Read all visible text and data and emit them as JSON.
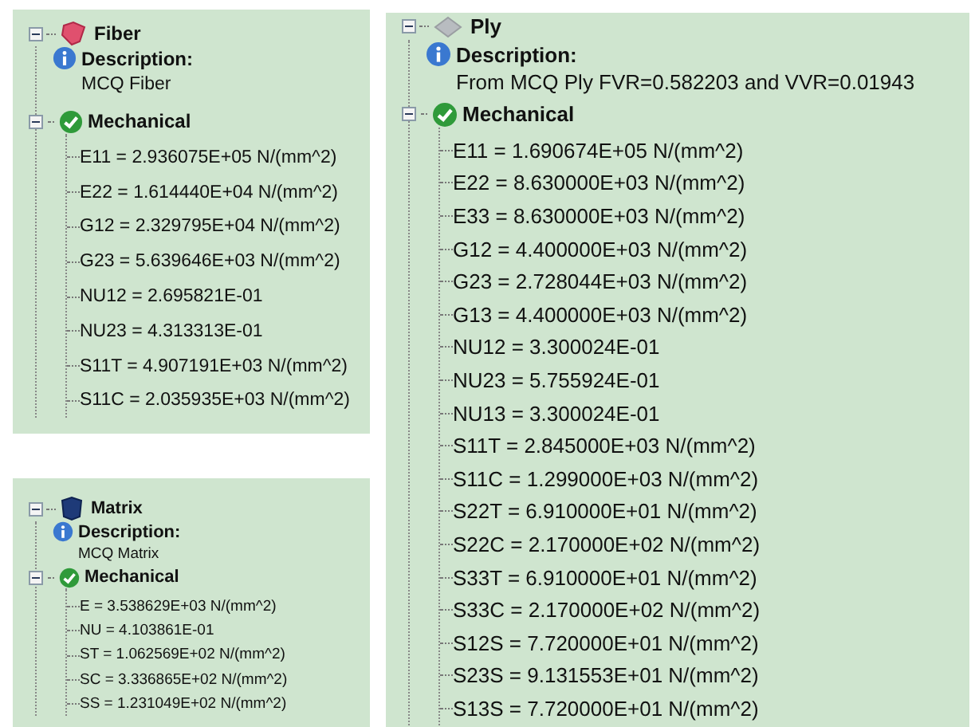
{
  "panels": [
    {
      "kind": "fiber",
      "title": "Fiber",
      "expanded": true,
      "description": {
        "label": "Description:",
        "text": "MCQ Fiber"
      },
      "mechanical": {
        "label": "Mechanical",
        "expanded": true,
        "properties": [
          "E11 = 2.936075E+05 N/(mm^2)",
          "E22 = 1.614440E+04 N/(mm^2)",
          "G12 = 2.329795E+04 N/(mm^2)",
          "G23 = 5.639646E+03 N/(mm^2)",
          "NU12 = 2.695821E-01",
          "NU23 = 4.313313E-01",
          "S11T = 4.907191E+03 N/(mm^2)",
          "S11C = 2.035935E+03 N/(mm^2)"
        ]
      }
    },
    {
      "kind": "matrix",
      "title": "Matrix",
      "expanded": true,
      "description": {
        "label": "Description:",
        "text": "MCQ Matrix"
      },
      "mechanical": {
        "label": "Mechanical",
        "expanded": true,
        "properties": [
          "E = 3.538629E+03 N/(mm^2)",
          "NU = 4.103861E-01",
          "ST = 1.062569E+02 N/(mm^2)",
          "SC = 3.336865E+02 N/(mm^2)",
          "SS = 1.231049E+02 N/(mm^2)"
        ]
      }
    },
    {
      "kind": "ply",
      "title": "Ply",
      "expanded": true,
      "description": {
        "label": "Description:",
        "text": "From MCQ Ply FVR=0.582203 and VVR=0.01943"
      },
      "mechanical": {
        "label": "Mechanical",
        "expanded": true,
        "properties": [
          "E11 = 1.690674E+05 N/(mm^2)",
          "E22 = 8.630000E+03 N/(mm^2)",
          "E33 = 8.630000E+03 N/(mm^2)",
          "G12 = 4.400000E+03 N/(mm^2)",
          "G23 = 2.728044E+03 N/(mm^2)",
          "G13 = 4.400000E+03 N/(mm^2)",
          "NU12 = 3.300024E-01",
          "NU23 = 5.755924E-01",
          "NU13 = 3.300024E-01",
          "S11T = 2.845000E+03 N/(mm^2)",
          "S11C = 1.299000E+03 N/(mm^2)",
          "S22T = 6.910000E+01 N/(mm^2)",
          "S22C = 2.170000E+02 N/(mm^2)",
          "S33T = 6.910000E+01 N/(mm^2)",
          "S33C = 2.170000E+02 N/(mm^2)",
          "S12S = 7.720000E+01 N/(mm^2)",
          "S23S = 9.131553E+01 N/(mm^2)",
          "S13S = 7.720000E+01 N/(mm^2)"
        ]
      }
    }
  ]
}
